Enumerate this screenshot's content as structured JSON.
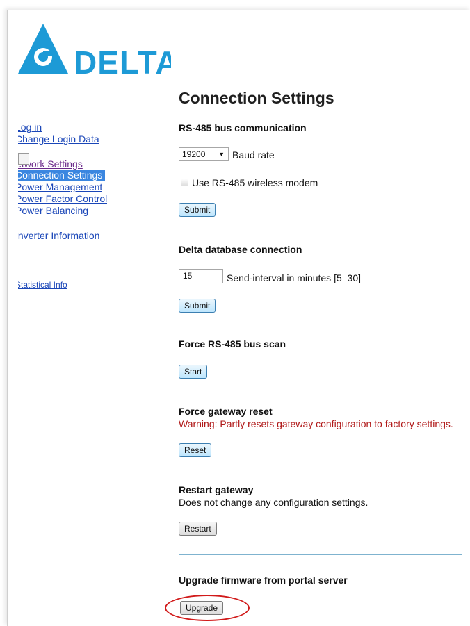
{
  "brand": {
    "name": "DELTA",
    "color": "#1d9ad6"
  },
  "sidebar": {
    "login": "Log in",
    "change_login": "Change Login Data",
    "network": "Network Settings",
    "connection": "Connection Settings",
    "power_management": "Power Management",
    "power_factor": "Power Factor Control",
    "power_balancing": "Power Balancing",
    "inverter_info": "Inverter Information",
    "statistical": "Statistical Info"
  },
  "page": {
    "title": "Connection Settings"
  },
  "rs485": {
    "heading": "RS-485 bus communication",
    "baud_value": "19200",
    "baud_label": "Baud rate",
    "wireless_label": "Use RS-485 wireless modem",
    "wireless_checked": false,
    "submit": "Submit"
  },
  "database": {
    "heading": "Delta database connection",
    "interval_value": "15",
    "interval_label": "Send-interval in minutes [5–30]",
    "submit": "Submit"
  },
  "bus_scan": {
    "heading": "Force RS-485 bus scan",
    "button": "Start"
  },
  "gateway_reset": {
    "heading": "Force gateway reset",
    "warning": "Warning: Partly resets gateway configuration to factory settings.",
    "button": "Reset"
  },
  "restart": {
    "heading": "Restart gateway",
    "note": "Does not change any configuration settings.",
    "button": "Restart"
  },
  "firmware": {
    "heading": "Upgrade firmware from portal server",
    "button": "Upgrade"
  }
}
